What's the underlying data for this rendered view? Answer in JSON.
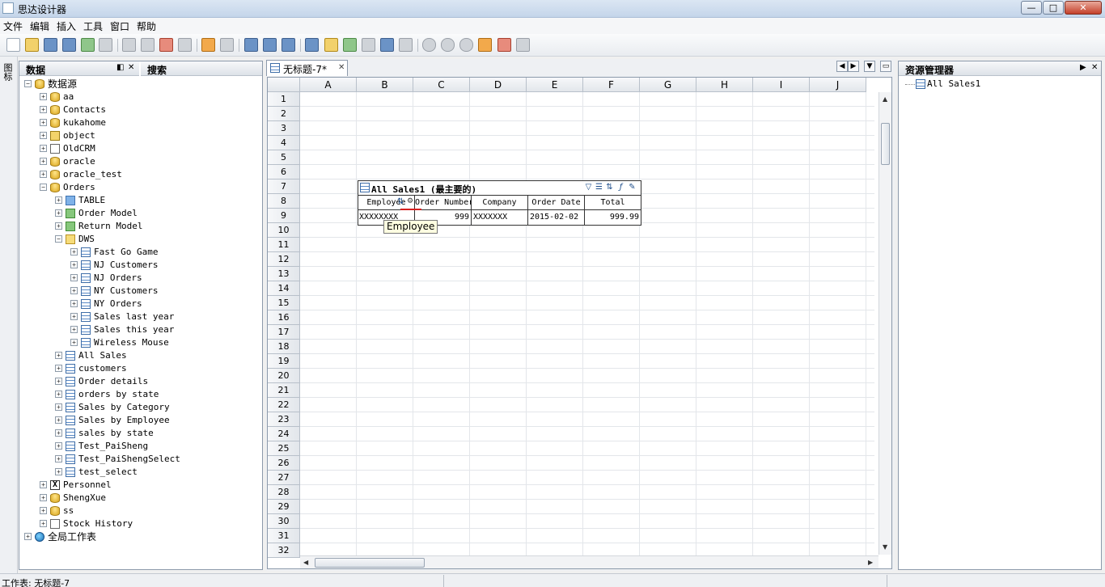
{
  "window": {
    "title": "思达设计器",
    "controls": {
      "minimize": "—",
      "maximize": "□",
      "close": "✕"
    }
  },
  "menubar": {
    "items": [
      "文件",
      "编辑",
      "插入",
      "工具",
      "窗口",
      "帮助"
    ]
  },
  "toolbar": {
    "icons": [
      "new-icon",
      "open-icon",
      "save-icon",
      "save-all-icon",
      "export-icon",
      "print-icon",
      "cut-icon",
      "copy-icon",
      "delete-icon",
      "paste-icon",
      "undo-icon",
      "redo-icon",
      "refresh-icon",
      "layout-icon",
      "reload-icon",
      "tool-icon",
      "datasource-icon",
      "add-icon",
      "filter-icon",
      "group-icon",
      "sort-icon",
      "shape1-icon",
      "shape2-icon",
      "shape3-icon",
      "grid-icon",
      "row-icon",
      "col-icon"
    ]
  },
  "side_tab": {
    "label": "图标"
  },
  "left_panel": {
    "tabs": [
      {
        "label": "数据"
      },
      {
        "label": "搜索"
      }
    ],
    "tree": [
      {
        "label": "数据源",
        "icon": "database-icon",
        "level": 0,
        "expanded": true
      },
      {
        "label": "aa",
        "icon": "database-icon",
        "level": 1
      },
      {
        "label": "Contacts",
        "icon": "database-icon",
        "level": 1
      },
      {
        "label": "kukahome",
        "icon": "database-icon",
        "level": 1
      },
      {
        "label": "object",
        "icon": "object-icon",
        "level": 1
      },
      {
        "label": "OldCRM",
        "icon": "page-icon",
        "level": 1
      },
      {
        "label": "oracle",
        "icon": "database-icon",
        "level": 1
      },
      {
        "label": "oracle_test",
        "icon": "database-icon",
        "level": 1
      },
      {
        "label": "Orders",
        "icon": "database-icon",
        "level": 1,
        "expanded": true
      },
      {
        "label": "TABLE",
        "icon": "folder-icon",
        "level": 2
      },
      {
        "label": "Order Model",
        "icon": "green-folder-icon",
        "level": 2
      },
      {
        "label": "Return Model",
        "icon": "green-folder-icon",
        "level": 2
      },
      {
        "label": "DWS",
        "icon": "yellow-folder-icon",
        "level": 2,
        "expanded": true
      },
      {
        "label": "Fast Go Game",
        "icon": "table-icon",
        "level": 3
      },
      {
        "label": "NJ Customers",
        "icon": "table-icon",
        "level": 3
      },
      {
        "label": "NJ Orders",
        "icon": "table-icon",
        "level": 3
      },
      {
        "label": "NY Customers",
        "icon": "table-icon",
        "level": 3
      },
      {
        "label": "NY Orders",
        "icon": "table-icon",
        "level": 3
      },
      {
        "label": "Sales last year",
        "icon": "table-icon",
        "level": 3
      },
      {
        "label": "Sales this year",
        "icon": "table-icon",
        "level": 3
      },
      {
        "label": "Wireless Mouse",
        "icon": "table-icon",
        "level": 3
      },
      {
        "label": "All Sales",
        "icon": "table-icon",
        "level": 2
      },
      {
        "label": "customers",
        "icon": "table-icon",
        "level": 2
      },
      {
        "label": "Order details",
        "icon": "table-icon",
        "level": 2
      },
      {
        "label": "orders by state",
        "icon": "table-icon",
        "level": 2
      },
      {
        "label": "Sales by Category",
        "icon": "table-icon",
        "level": 2
      },
      {
        "label": "Sales by Employee",
        "icon": "table-icon",
        "level": 2
      },
      {
        "label": "sales by state",
        "icon": "table-icon",
        "level": 2
      },
      {
        "label": "Test_PaiSheng",
        "icon": "table-icon",
        "level": 2
      },
      {
        "label": "Test_PaiShengSelect",
        "icon": "table-icon",
        "level": 2
      },
      {
        "label": "test_select",
        "icon": "table-icon",
        "level": 2
      },
      {
        "label": "Personnel",
        "icon": "excel-icon",
        "level": 1
      },
      {
        "label": "ShengXue",
        "icon": "database-icon",
        "level": 1
      },
      {
        "label": "ss",
        "icon": "database-icon",
        "level": 1
      },
      {
        "label": "Stock History",
        "icon": "page-icon",
        "level": 1
      },
      {
        "label": "全局工作表",
        "icon": "globe-icon",
        "level": 0
      }
    ]
  },
  "document": {
    "tab": {
      "label": "无标题-7*",
      "close": "✕"
    },
    "columns": [
      "A",
      "B",
      "C",
      "D",
      "E",
      "F",
      "G",
      "H",
      "I",
      "J"
    ],
    "rows": [
      "1",
      "2",
      "3",
      "4",
      "5",
      "6",
      "7",
      "8",
      "9",
      "10",
      "11",
      "12",
      "13",
      "14",
      "15",
      "16",
      "17",
      "18",
      "19",
      "20",
      "21",
      "22",
      "23",
      "24",
      "25",
      "26",
      "27",
      "28",
      "29",
      "30",
      "31",
      "32"
    ],
    "grid_component": {
      "title": "All Sales1 (最主要的)",
      "headers": [
        "Employee",
        "Order Number",
        "Company",
        "Order Date",
        "Total"
      ],
      "row": [
        "XXXXXXXX",
        "999",
        "XXXXXXX",
        "2015-02-02",
        "999.99"
      ],
      "tool_icons": [
        "funnel-icon",
        "list-icon",
        "sort-icon",
        "formula-icon",
        "edit-icon"
      ]
    },
    "tooltip": "Employee"
  },
  "right_panel": {
    "title": "资源管理器",
    "tree": [
      {
        "label": "All Sales1",
        "icon": "table-icon"
      }
    ]
  },
  "statusbar": {
    "segments": [
      "工作表: 无标题-7",
      "",
      ""
    ]
  }
}
